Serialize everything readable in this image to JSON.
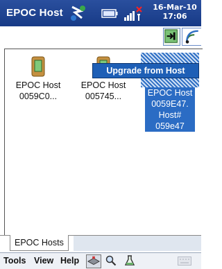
{
  "titlebar": {
    "title": "EPOC Host",
    "clock_date": "16-Mar-10",
    "clock_time": "17:06",
    "colors": {
      "bar": "#173a86",
      "text": "#ffffff",
      "alert": "#ff2020"
    }
  },
  "toolbar": {
    "buttons": [
      {
        "icon": "synchronize-icon"
      },
      {
        "icon": "wireless-icon"
      }
    ]
  },
  "hosts": [
    {
      "line1": "EPOC Host",
      "line2": "0059C0...",
      "selected": false
    },
    {
      "line1": "EPOC Host",
      "line2": "005745...",
      "selected": false
    },
    {
      "line1": "EPOC Host",
      "line2": "0059E47.",
      "line3": "Host#",
      "line4": "059e47",
      "selected": true
    }
  ],
  "context_menu": {
    "item": "Upgrade from Host"
  },
  "tabs": [
    {
      "label": "EPOC Hosts",
      "active": true
    }
  ],
  "menubar": {
    "tools": "Tools",
    "view": "View",
    "help": "Help",
    "icons": [
      "host-menu-icon",
      "search-icon",
      "lab-icon",
      "keyboard-icon"
    ]
  },
  "colors": {
    "selection": "#2b6cc4",
    "menu": "#1e5fb6",
    "accent": "#2a4f9e"
  }
}
